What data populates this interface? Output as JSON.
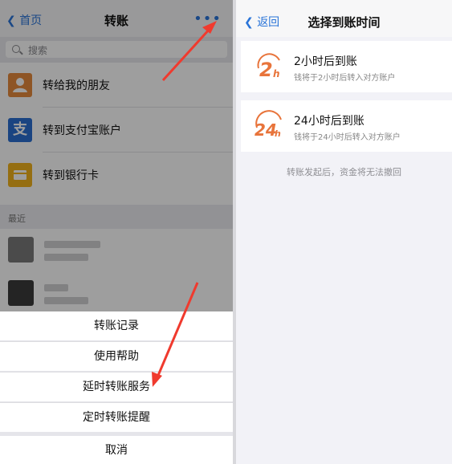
{
  "left": {
    "nav": {
      "back_label": "首页",
      "title": "转账",
      "more_glyph": "•••"
    },
    "search": {
      "placeholder": "搜索"
    },
    "options": [
      {
        "label": "转给我的朋友",
        "icon": "friend-icon",
        "color": "#e58a3c"
      },
      {
        "label": "转到支付宝账户",
        "icon": "alipay-icon",
        "color": "#2b6fd1"
      },
      {
        "label": "转到银行卡",
        "icon": "bank-card-icon",
        "color": "#f0b21c"
      }
    ],
    "section": {
      "label": "最近"
    },
    "sheet": {
      "items": [
        "转账记录",
        "使用帮助",
        "延时转账服务",
        "定时转账提醒"
      ],
      "cancel": "取消"
    }
  },
  "right": {
    "nav": {
      "back_label": "返回",
      "title": "选择到账时间"
    },
    "options": [
      {
        "title": "2小时后到账",
        "subtitle": "钱将于2小时后转入对方账户",
        "badge": "2h"
      },
      {
        "title": "24小时后到账",
        "subtitle": "钱将于24小时后转入对方账户",
        "badge": "24h"
      }
    ],
    "note": "转账发起后，资金将无法撤回"
  },
  "colors": {
    "accent": "#2a74d8",
    "annotation_arrow": "#f03a2e",
    "badge": "#e8743b"
  }
}
